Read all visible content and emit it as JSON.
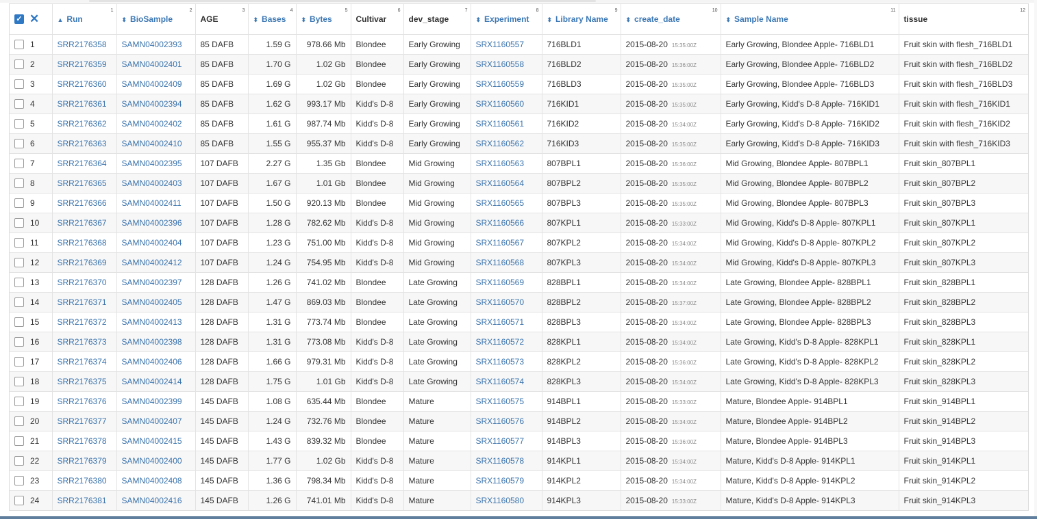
{
  "table": {
    "select_all_icon": "check-square-icon",
    "clear_icon": "close-icon",
    "columns": [
      {
        "label": "Run",
        "num": "1",
        "sort": "▲",
        "link": true
      },
      {
        "label": "BioSample",
        "num": "2",
        "sort": "⬍",
        "link": true
      },
      {
        "label": "AGE",
        "num": "3",
        "sort": "",
        "link": false
      },
      {
        "label": "Bases",
        "num": "4",
        "sort": "⬍",
        "link": true
      },
      {
        "label": "Bytes",
        "num": "5",
        "sort": "⬍",
        "link": true
      },
      {
        "label": "Cultivar",
        "num": "6",
        "sort": "",
        "link": false
      },
      {
        "label": "dev_stage",
        "num": "7",
        "sort": "",
        "link": false
      },
      {
        "label": "Experiment",
        "num": "8",
        "sort": "⬍",
        "link": true
      },
      {
        "label": "Library Name",
        "num": "9",
        "sort": "⬍",
        "link": true
      },
      {
        "label": "create_date",
        "num": "10",
        "sort": "⬍",
        "link": true
      },
      {
        "label": "Sample Name",
        "num": "11",
        "sort": "⬍",
        "link": true
      },
      {
        "label": "tissue",
        "num": "12",
        "sort": "",
        "link": false
      }
    ],
    "rows": [
      {
        "n": "1",
        "run": "SRR2176358",
        "biosample": "SAMN04002393",
        "age": "85 DAFB",
        "bases": "1.59 G",
        "bytes": "978.66 Mb",
        "cultivar": "Blondee",
        "dev_stage": "Early Growing",
        "experiment": "SRX1160557",
        "library": "716BLD1",
        "date": "2015-08-20",
        "time": "15:35:00Z",
        "sample": "Early Growing, Blondee Apple- 716BLD1",
        "tissue": "Fruit skin with flesh_716BLD1"
      },
      {
        "n": "2",
        "run": "SRR2176359",
        "biosample": "SAMN04002401",
        "age": "85 DAFB",
        "bases": "1.70 G",
        "bytes": "1.02 Gb",
        "cultivar": "Blondee",
        "dev_stage": "Early Growing",
        "experiment": "SRX1160558",
        "library": "716BLD2",
        "date": "2015-08-20",
        "time": "15:36:00Z",
        "sample": "Early Growing, Blondee Apple- 716BLD2",
        "tissue": "Fruit skin with flesh_716BLD2"
      },
      {
        "n": "3",
        "run": "SRR2176360",
        "biosample": "SAMN04002409",
        "age": "85 DAFB",
        "bases": "1.69 G",
        "bytes": "1.02 Gb",
        "cultivar": "Blondee",
        "dev_stage": "Early Growing",
        "experiment": "SRX1160559",
        "library": "716BLD3",
        "date": "2015-08-20",
        "time": "15:35:00Z",
        "sample": "Early Growing, Blondee Apple- 716BLD3",
        "tissue": "Fruit skin with flesh_716BLD3"
      },
      {
        "n": "4",
        "run": "SRR2176361",
        "biosample": "SAMN04002394",
        "age": "85 DAFB",
        "bases": "1.62 G",
        "bytes": "993.17 Mb",
        "cultivar": "Kidd's D-8",
        "dev_stage": "Early Growing",
        "experiment": "SRX1160560",
        "library": "716KID1",
        "date": "2015-08-20",
        "time": "15:35:00Z",
        "sample": "Early Growing, Kidd's D-8 Apple- 716KID1",
        "tissue": "Fruit skin with flesh_716KID1"
      },
      {
        "n": "5",
        "run": "SRR2176362",
        "biosample": "SAMN04002402",
        "age": "85 DAFB",
        "bases": "1.61 G",
        "bytes": "987.74 Mb",
        "cultivar": "Kidd's D-8",
        "dev_stage": "Early Growing",
        "experiment": "SRX1160561",
        "library": "716KID2",
        "date": "2015-08-20",
        "time": "15:34:00Z",
        "sample": "Early Growing, Kidd's D-8 Apple- 716KID2",
        "tissue": "Fruit skin with flesh_716KID2"
      },
      {
        "n": "6",
        "run": "SRR2176363",
        "biosample": "SAMN04002410",
        "age": "85 DAFB",
        "bases": "1.55 G",
        "bytes": "955.37 Mb",
        "cultivar": "Kidd's D-8",
        "dev_stage": "Early Growing",
        "experiment": "SRX1160562",
        "library": "716KID3",
        "date": "2015-08-20",
        "time": "15:35:00Z",
        "sample": "Early Growing, Kidd's D-8 Apple- 716KID3",
        "tissue": "Fruit skin with flesh_716KID3"
      },
      {
        "n": "7",
        "run": "SRR2176364",
        "biosample": "SAMN04002395",
        "age": "107 DAFB",
        "bases": "2.27 G",
        "bytes": "1.35 Gb",
        "cultivar": "Blondee",
        "dev_stage": "Mid Growing",
        "experiment": "SRX1160563",
        "library": "807BPL1",
        "date": "2015-08-20",
        "time": "15:36:00Z",
        "sample": "Mid Growing, Blondee Apple- 807BPL1",
        "tissue": "Fruit skin_807BPL1"
      },
      {
        "n": "8",
        "run": "SRR2176365",
        "biosample": "SAMN04002403",
        "age": "107 DAFB",
        "bases": "1.67 G",
        "bytes": "1.01 Gb",
        "cultivar": "Blondee",
        "dev_stage": "Mid Growing",
        "experiment": "SRX1160564",
        "library": "807BPL2",
        "date": "2015-08-20",
        "time": "15:35:00Z",
        "sample": "Mid Growing, Blondee Apple- 807BPL2",
        "tissue": "Fruit skin_807BPL2"
      },
      {
        "n": "9",
        "run": "SRR2176366",
        "biosample": "SAMN04002411",
        "age": "107 DAFB",
        "bases": "1.50 G",
        "bytes": "920.13 Mb",
        "cultivar": "Blondee",
        "dev_stage": "Mid Growing",
        "experiment": "SRX1160565",
        "library": "807BPL3",
        "date": "2015-08-20",
        "time": "15:35:00Z",
        "sample": "Mid Growing, Blondee Apple- 807BPL3",
        "tissue": "Fruit skin_807BPL3"
      },
      {
        "n": "10",
        "run": "SRR2176367",
        "biosample": "SAMN04002396",
        "age": "107 DAFB",
        "bases": "1.28 G",
        "bytes": "782.62 Mb",
        "cultivar": "Kidd's D-8",
        "dev_stage": "Mid Growing",
        "experiment": "SRX1160566",
        "library": "807KPL1",
        "date": "2015-08-20",
        "time": "15:33:00Z",
        "sample": "Mid Growing, Kidd's D-8 Apple- 807KPL1",
        "tissue": "Fruit skin_807KPL1"
      },
      {
        "n": "11",
        "run": "SRR2176368",
        "biosample": "SAMN04002404",
        "age": "107 DAFB",
        "bases": "1.23 G",
        "bytes": "751.00 Mb",
        "cultivar": "Kidd's D-8",
        "dev_stage": "Mid Growing",
        "experiment": "SRX1160567",
        "library": "807KPL2",
        "date": "2015-08-20",
        "time": "15:34:00Z",
        "sample": "Mid Growing, Kidd's D-8 Apple- 807KPL2",
        "tissue": "Fruit skin_807KPL2"
      },
      {
        "n": "12",
        "run": "SRR2176369",
        "biosample": "SAMN04002412",
        "age": "107 DAFB",
        "bases": "1.24 G",
        "bytes": "754.95 Mb",
        "cultivar": "Kidd's D-8",
        "dev_stage": "Mid Growing",
        "experiment": "SRX1160568",
        "library": "807KPL3",
        "date": "2015-08-20",
        "time": "15:34:00Z",
        "sample": "Mid Growing, Kidd's D-8 Apple- 807KPL3",
        "tissue": "Fruit skin_807KPL3"
      },
      {
        "n": "13",
        "run": "SRR2176370",
        "biosample": "SAMN04002397",
        "age": "128 DAFB",
        "bases": "1.26 G",
        "bytes": "741.02 Mb",
        "cultivar": "Blondee",
        "dev_stage": "Late Growing",
        "experiment": "SRX1160569",
        "library": "828BPL1",
        "date": "2015-08-20",
        "time": "15:34:00Z",
        "sample": "Late Growing, Blondee Apple- 828BPL1",
        "tissue": "Fruit skin_828BPL1"
      },
      {
        "n": "14",
        "run": "SRR2176371",
        "biosample": "SAMN04002405",
        "age": "128 DAFB",
        "bases": "1.47 G",
        "bytes": "869.03 Mb",
        "cultivar": "Blondee",
        "dev_stage": "Late Growing",
        "experiment": "SRX1160570",
        "library": "828BPL2",
        "date": "2015-08-20",
        "time": "15:37:00Z",
        "sample": "Late Growing, Blondee Apple- 828BPL2",
        "tissue": "Fruit skin_828BPL2"
      },
      {
        "n": "15",
        "run": "SRR2176372",
        "biosample": "SAMN04002413",
        "age": "128 DAFB",
        "bases": "1.31 G",
        "bytes": "773.74 Mb",
        "cultivar": "Blondee",
        "dev_stage": "Late Growing",
        "experiment": "SRX1160571",
        "library": "828BPL3",
        "date": "2015-08-20",
        "time": "15:34:00Z",
        "sample": "Late Growing, Blondee Apple- 828BPL3",
        "tissue": "Fruit skin_828BPL3"
      },
      {
        "n": "16",
        "run": "SRR2176373",
        "biosample": "SAMN04002398",
        "age": "128 DAFB",
        "bases": "1.31 G",
        "bytes": "773.08 Mb",
        "cultivar": "Kidd's D-8",
        "dev_stage": "Late Growing",
        "experiment": "SRX1160572",
        "library": "828KPL1",
        "date": "2015-08-20",
        "time": "15:34:00Z",
        "sample": "Late Growing, Kidd's D-8 Apple- 828KPL1",
        "tissue": "Fruit skin_828KPL1"
      },
      {
        "n": "17",
        "run": "SRR2176374",
        "biosample": "SAMN04002406",
        "age": "128 DAFB",
        "bases": "1.66 G",
        "bytes": "979.31 Mb",
        "cultivar": "Kidd's D-8",
        "dev_stage": "Late Growing",
        "experiment": "SRX1160573",
        "library": "828KPL2",
        "date": "2015-08-20",
        "time": "15:36:00Z",
        "sample": "Late Growing, Kidd's D-8 Apple- 828KPL2",
        "tissue": "Fruit skin_828KPL2"
      },
      {
        "n": "18",
        "run": "SRR2176375",
        "biosample": "SAMN04002414",
        "age": "128 DAFB",
        "bases": "1.75 G",
        "bytes": "1.01 Gb",
        "cultivar": "Kidd's D-8",
        "dev_stage": "Late Growing",
        "experiment": "SRX1160574",
        "library": "828KPL3",
        "date": "2015-08-20",
        "time": "15:34:00Z",
        "sample": "Late Growing, Kidd's D-8 Apple- 828KPL3",
        "tissue": "Fruit skin_828KPL3"
      },
      {
        "n": "19",
        "run": "SRR2176376",
        "biosample": "SAMN04002399",
        "age": "145 DAFB",
        "bases": "1.08 G",
        "bytes": "635.44 Mb",
        "cultivar": "Blondee",
        "dev_stage": "Mature",
        "experiment": "SRX1160575",
        "library": "914BPL1",
        "date": "2015-08-20",
        "time": "15:33:00Z",
        "sample": "Mature, Blondee Apple- 914BPL1",
        "tissue": "Fruit skin_914BPL1"
      },
      {
        "n": "20",
        "run": "SRR2176377",
        "biosample": "SAMN04002407",
        "age": "145 DAFB",
        "bases": "1.24 G",
        "bytes": "732.76 Mb",
        "cultivar": "Blondee",
        "dev_stage": "Mature",
        "experiment": "SRX1160576",
        "library": "914BPL2",
        "date": "2015-08-20",
        "time": "15:34:00Z",
        "sample": "Mature, Blondee Apple- 914BPL2",
        "tissue": "Fruit skin_914BPL2"
      },
      {
        "n": "21",
        "run": "SRR2176378",
        "biosample": "SAMN04002415",
        "age": "145 DAFB",
        "bases": "1.43 G",
        "bytes": "839.32 Mb",
        "cultivar": "Blondee",
        "dev_stage": "Mature",
        "experiment": "SRX1160577",
        "library": "914BPL3",
        "date": "2015-08-20",
        "time": "15:36:00Z",
        "sample": "Mature, Blondee Apple- 914BPL3",
        "tissue": "Fruit skin_914BPL3"
      },
      {
        "n": "22",
        "run": "SRR2176379",
        "biosample": "SAMN04002400",
        "age": "145 DAFB",
        "bases": "1.77 G",
        "bytes": "1.02 Gb",
        "cultivar": "Kidd's D-8",
        "dev_stage": "Mature",
        "experiment": "SRX1160578",
        "library": "914KPL1",
        "date": "2015-08-20",
        "time": "15:34:00Z",
        "sample": "Mature, Kidd's D-8 Apple- 914KPL1",
        "tissue": "Fruit skin_914KPL1"
      },
      {
        "n": "23",
        "run": "SRR2176380",
        "biosample": "SAMN04002408",
        "age": "145 DAFB",
        "bases": "1.36 G",
        "bytes": "798.34 Mb",
        "cultivar": "Kidd's D-8",
        "dev_stage": "Mature",
        "experiment": "SRX1160579",
        "library": "914KPL2",
        "date": "2015-08-20",
        "time": "15:34:00Z",
        "sample": "Mature, Kidd's D-8 Apple- 914KPL2",
        "tissue": "Fruit skin_914KPL2"
      },
      {
        "n": "24",
        "run": "SRR2176381",
        "biosample": "SAMN04002416",
        "age": "145 DAFB",
        "bases": "1.26 G",
        "bytes": "741.01 Mb",
        "cultivar": "Kidd's D-8",
        "dev_stage": "Mature",
        "experiment": "SRX1160580",
        "library": "914KPL3",
        "date": "2015-08-20",
        "time": "15:33:00Z",
        "sample": "Mature, Kidd's D-8 Apple- 914KPL3",
        "tissue": "Fruit skin_914KPL3"
      }
    ]
  },
  "colors": {
    "link": "#3a73ad",
    "accent": "#2f78c4",
    "stripe": "#f7f7f7"
  }
}
